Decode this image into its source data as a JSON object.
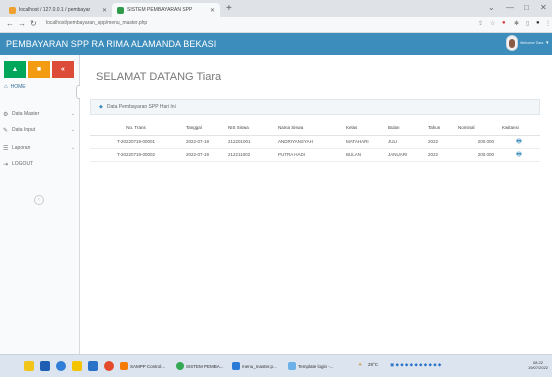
{
  "browser": {
    "tabs": [
      {
        "label": "localhost / 127.0.0.1 / pembayar",
        "active": false
      },
      {
        "label": "SISTEM PEMBAYARAN SPP",
        "active": true
      }
    ],
    "new_tab": "+",
    "url": "localhost/pembayaran_spp/menu_master.php"
  },
  "app": {
    "title": "PEMBAYARAN SPP RA RIMA ALAMANDA BEKASI",
    "user": {
      "label": "Welcome Tiara"
    },
    "colors": {
      "header": "#3c8dbc",
      "btn_green": "#00a65a",
      "btn_yellow": "#f39c12",
      "btn_red": "#dd4b39"
    }
  },
  "sidebar": {
    "home": "HOME",
    "items": [
      {
        "label": "Data Master",
        "icon": "gears-icon"
      },
      {
        "label": "Data Input",
        "icon": "edit-icon"
      },
      {
        "label": "Laporan",
        "icon": "list-icon"
      },
      {
        "label": "LOGOUT",
        "icon": "logout-icon"
      }
    ]
  },
  "main": {
    "welcome": "SELAMAT DATANG Tiara",
    "panel_title": "Data Pembayaran SPP Hari Ini",
    "table": {
      "headers": [
        "No. Trans",
        "Tanggal",
        "NIS Siswa",
        "Nama Siswa",
        "Kelas",
        "Bulan",
        "Tahun",
        "Nominal",
        "Kwitansi"
      ],
      "rows": [
        [
          "T-20220719-00001",
          "2022-07-19",
          "212201001",
          "ANDRIYANSYAH",
          "MATAHARI",
          "JULI",
          "2022",
          "200.000"
        ],
        [
          "T-20220719-00002",
          "2022-07-19",
          "212211002",
          "PUTRA HADI",
          "BULAN",
          "JANUARI",
          "2022",
          "200.000"
        ]
      ]
    }
  },
  "taskbar": {
    "apps": [
      {
        "label": "SAMPP Control..."
      },
      {
        "label": "SISTEM PEMBA..."
      },
      {
        "label": "menu_master.p..."
      },
      {
        "label": "Template login -..."
      }
    ],
    "weather": "29°C",
    "clock_time": "08.22",
    "clock_date": "19/07/2022"
  }
}
